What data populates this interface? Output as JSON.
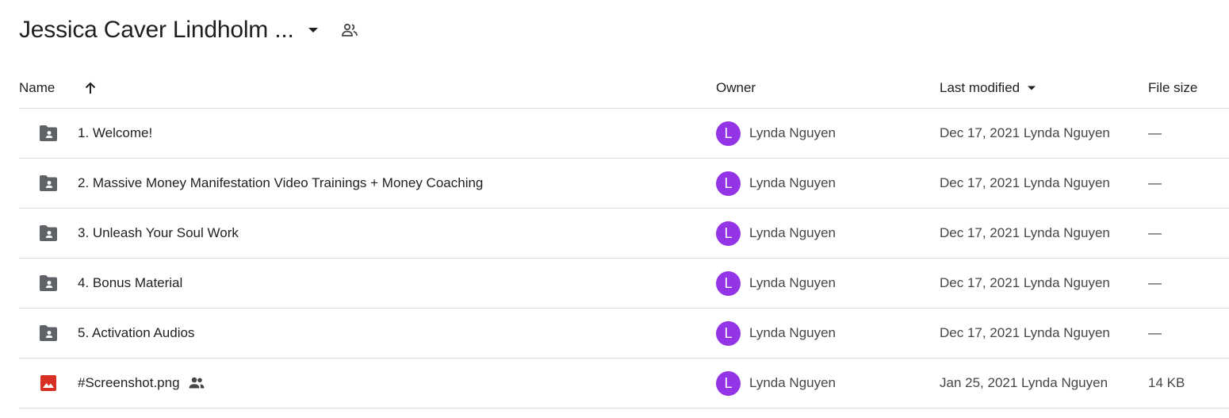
{
  "header": {
    "folder_title": "Jessica Caver Lindholm ...",
    "title_caret_icon": "arrow-drop-down-icon",
    "shared_icon": "people-icon"
  },
  "columns": {
    "name": "Name",
    "owner": "Owner",
    "last_modified": "Last modified",
    "file_size": "File size",
    "sort_icon": "arrow-up-icon"
  },
  "colors": {
    "avatar": "#9334e6",
    "folder_icon": "#5f6368",
    "image_icon": "#d93025",
    "divider": "#dadce0"
  },
  "rows": [
    {
      "type": "shared-folder",
      "icon": "shared-folder-icon",
      "name": "1. Welcome!",
      "owner_initial": "L",
      "owner": "Lynda Nguyen",
      "modified": "Dec 17, 2021 Lynda Nguyen",
      "size": "—"
    },
    {
      "type": "shared-folder",
      "icon": "shared-folder-icon",
      "name": "2. Massive Money Manifestation Video Trainings + Money Coaching",
      "owner_initial": "L",
      "owner": "Lynda Nguyen",
      "modified": "Dec 17, 2021 Lynda Nguyen",
      "size": "—"
    },
    {
      "type": "shared-folder",
      "icon": "shared-folder-icon",
      "name": "3. Unleash Your Soul Work",
      "owner_initial": "L",
      "owner": "Lynda Nguyen",
      "modified": "Dec 17, 2021 Lynda Nguyen",
      "size": "—"
    },
    {
      "type": "shared-folder",
      "icon": "shared-folder-icon",
      "name": "4. Bonus Material",
      "owner_initial": "L",
      "owner": "Lynda Nguyen",
      "modified": "Dec 17, 2021 Lynda Nguyen",
      "size": "—"
    },
    {
      "type": "shared-folder",
      "icon": "shared-folder-icon",
      "name": "5. Activation Audios",
      "owner_initial": "L",
      "owner": "Lynda Nguyen",
      "modified": "Dec 17, 2021 Lynda Nguyen",
      "size": "—"
    },
    {
      "type": "image",
      "icon": "image-file-icon",
      "name": "#Screenshot.png",
      "shared": true,
      "owner_initial": "L",
      "owner": "Lynda Nguyen",
      "modified": "Jan 25, 2021 Lynda Nguyen",
      "size": "14 KB"
    }
  ]
}
